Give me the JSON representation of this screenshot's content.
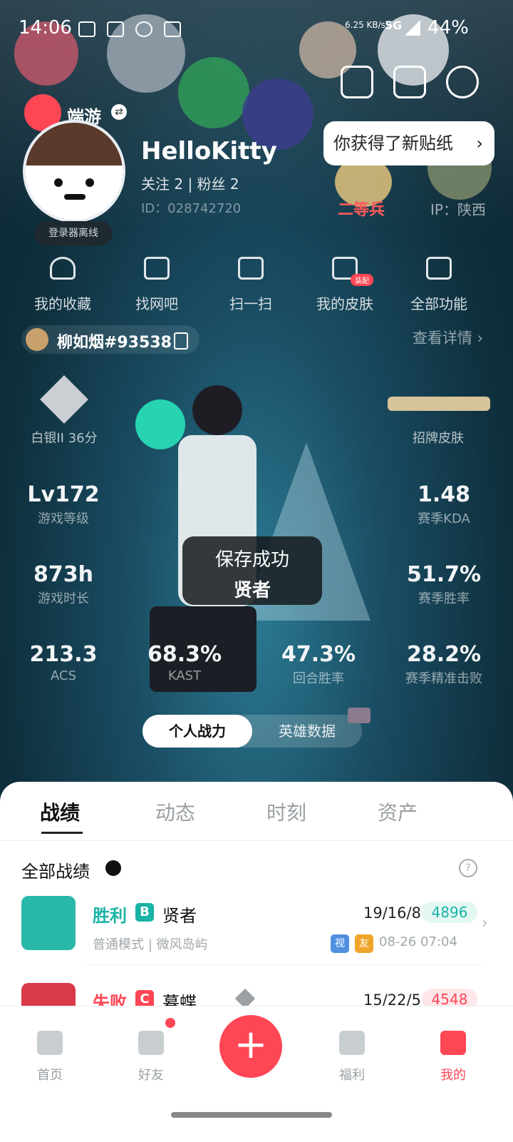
{
  "status_bar": {
    "time": "14:06",
    "net_speed": "6.25 KB/s",
    "network": "5G",
    "battery": "44%"
  },
  "header": {
    "app_name": "端游",
    "new_sticker_text": "你获得了新贴纸",
    "nickname": "HelloKitty",
    "follow_text": "关注 2  |  粉丝 2",
    "uid_text": "ID：028742720",
    "ip_text": "IP：陕西",
    "login_status": "登录器离线",
    "sticker_caption": "二等兵"
  },
  "quick_actions": [
    {
      "label": "我的收藏",
      "icon": "heart-icon"
    },
    {
      "label": "找网吧",
      "icon": "monitor-icon"
    },
    {
      "label": "扫一扫",
      "icon": "scan-icon"
    },
    {
      "label": "我的皮肤",
      "icon": "skin-icon",
      "tag": "装配"
    },
    {
      "label": "全部功能",
      "icon": "grid-icon"
    }
  ],
  "player": {
    "riot_id": "柳如烟#93538",
    "detail_link": "查看详情"
  },
  "rank": {
    "label": "白银II 36分"
  },
  "skin": {
    "label": "招牌皮肤"
  },
  "stats": [
    {
      "value": "Lv172",
      "label": "游戏等级"
    },
    {
      "value": "1.48",
      "label": "赛季KDA"
    },
    {
      "value": "873h",
      "label": "游戏时长"
    },
    {
      "value": "51.7%",
      "label": "赛季胜率"
    },
    {
      "value": "213.3",
      "label": "ACS"
    },
    {
      "value": "68.3%",
      "label": "KAST"
    },
    {
      "value": "47.3%",
      "label": "回合胜率"
    },
    {
      "value": "28.2%",
      "label": "赛季精准击败"
    }
  ],
  "toast": {
    "message": "保存成功",
    "agent_name": "贤者"
  },
  "segment": {
    "active": "个人战力",
    "inactive": "英雄数据"
  },
  "tabs": [
    "战绩",
    "动态",
    "时刻",
    "资产"
  ],
  "records": {
    "filter_label": "全部战绩",
    "help": "?",
    "items": [
      {
        "result": "胜利",
        "grade": "B",
        "agent": "贤者",
        "kda": "19/16/8",
        "score": "4896",
        "mode": "普通模式 | 微风岛屿",
        "time": "08-26 07:04",
        "tag1": "视",
        "tag2": "友"
      },
      {
        "result": "失败",
        "grade": "C",
        "agent": "暮蝶",
        "kda": "15/22/5",
        "score": "4548"
      }
    ]
  },
  "nav": [
    {
      "label": "首页"
    },
    {
      "label": "好友"
    },
    {
      "label": "+"
    },
    {
      "label": "福利"
    },
    {
      "label": "我的"
    }
  ],
  "colors": {
    "accent": "#ff4655",
    "win": "#1ab3a6",
    "loss": "#ff4655"
  }
}
